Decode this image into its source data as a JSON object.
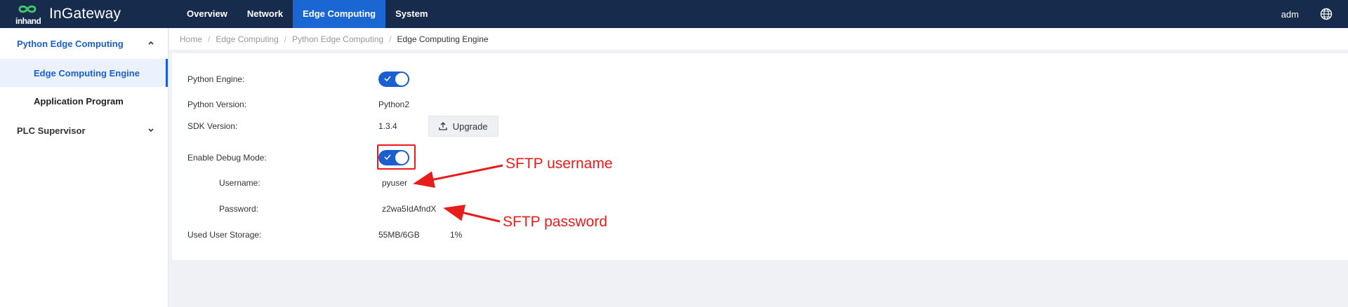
{
  "app": {
    "logo_small": "inhand",
    "logo_text": "InGateway",
    "user": "adm"
  },
  "nav": {
    "items": [
      {
        "label": "Overview"
      },
      {
        "label": "Network"
      },
      {
        "label": "Edge Computing",
        "active": true
      },
      {
        "label": "System"
      }
    ]
  },
  "sidebar": {
    "groups": [
      {
        "label": "Python Edge Computing",
        "open": true,
        "items": [
          {
            "label": "Edge Computing Engine",
            "active": true
          },
          {
            "label": "Application Program"
          }
        ]
      },
      {
        "label": "PLC Supervisor",
        "open": false,
        "items": []
      }
    ]
  },
  "breadcrumb": {
    "items": [
      "Home",
      "Edge Computing",
      "Python Edge Computing",
      "Edge Computing Engine"
    ]
  },
  "form": {
    "python_engine": {
      "label": "Python Engine:",
      "enabled": true
    },
    "python_version": {
      "label": "Python Version:",
      "value": "Python2"
    },
    "sdk_version": {
      "label": "SDK Version:",
      "value": "1.3.4",
      "button": "Upgrade"
    },
    "debug_mode": {
      "label": "Enable Debug Mode:",
      "enabled": true
    },
    "username": {
      "label": "Username:",
      "value": "pyuser"
    },
    "password": {
      "label": "Password:",
      "value": "z2wa5IdAfndX"
    },
    "storage": {
      "label": "Used User Storage:",
      "value": "55MB/6GB",
      "percent": "1%"
    }
  },
  "annotations": {
    "sftp_username": "SFTP username",
    "sftp_password": "SFTP password",
    "color": "#e91c1c"
  },
  "colors": {
    "topbar": "#172b4d",
    "accent": "#1a5fd0",
    "nav_active": "#1a66d2"
  }
}
